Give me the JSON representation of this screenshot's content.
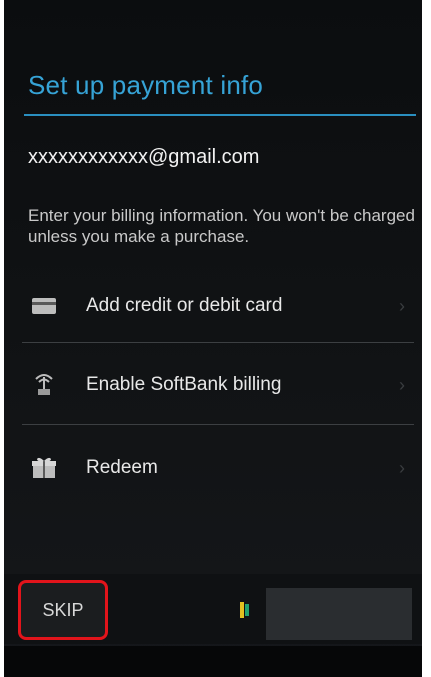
{
  "screen": {
    "title": "Set up payment info",
    "email": "xxxxxxxxxxxx@gmail.com",
    "description": "Enter your billing information. You won't be charged unless you make a purchase."
  },
  "options": [
    {
      "label": "Add credit or debit card",
      "icon": "credit-card-icon"
    },
    {
      "label": "Enable SoftBank billing",
      "icon": "carrier-billing-icon"
    },
    {
      "label": "Redeem",
      "icon": "gift-icon"
    }
  ],
  "footer": {
    "skip_label": "SKIP",
    "skip_highlight_color": "#e2141b"
  },
  "colors": {
    "accent": "#36a3d6",
    "background": "#111315",
    "text": "#e8e8e8"
  }
}
